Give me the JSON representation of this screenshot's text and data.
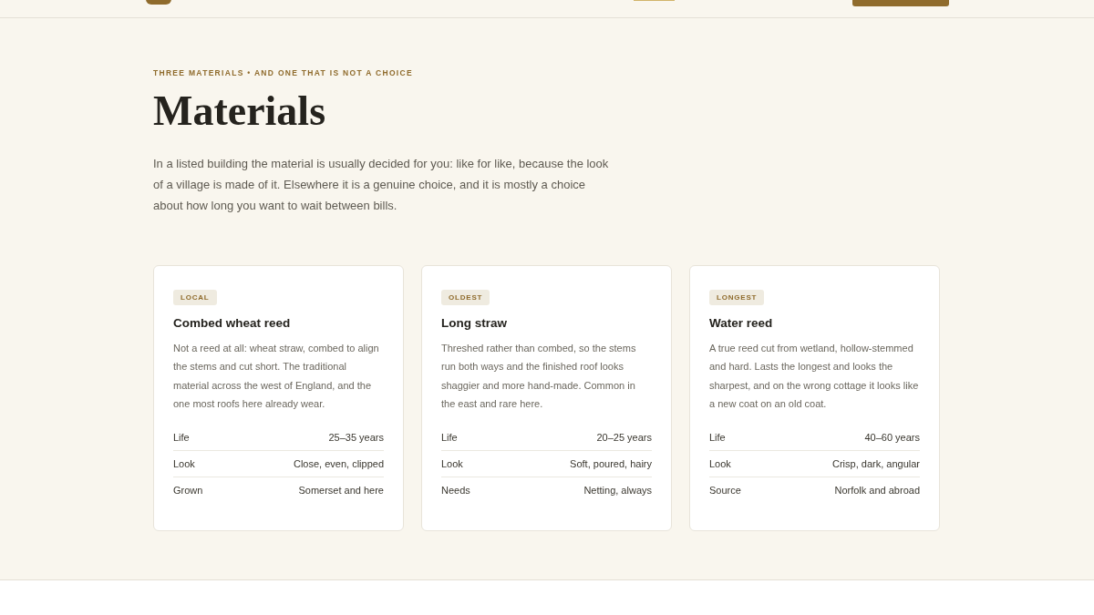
{
  "header": {
    "nav_active": true
  },
  "eyebrow": "THREE MATERIALS • AND ONE THAT IS NOT A CHOICE",
  "title": "Materials",
  "intro": "In a listed building the material is usually decided for you: like for like, because the look of a village is made of it. Elsewhere it is a genuine choice, and it is mostly a choice about how long you want to wait between bills.",
  "cards": [
    {
      "tag": "LOCAL",
      "name": "Combed wheat reed",
      "description": "Not a reed at all: wheat straw, combed to align the stems and cut short. The traditional material across the west of England, and the one most roofs here already wear.",
      "facts": [
        {
          "label": "Life",
          "value": "25–35 years"
        },
        {
          "label": "Look",
          "value": "Close, even, clipped"
        },
        {
          "label": "Grown",
          "value": "Somerset and here"
        }
      ]
    },
    {
      "tag": "OLDEST",
      "name": "Long straw",
      "description": "Threshed rather than combed, so the stems run both ways and the finished roof looks shaggier and more hand-made. Common in the east and rare here.",
      "facts": [
        {
          "label": "Life",
          "value": "20–25 years"
        },
        {
          "label": "Look",
          "value": "Soft, poured, hairy"
        },
        {
          "label": "Needs",
          "value": "Netting, always"
        }
      ]
    },
    {
      "tag": "LONGEST",
      "name": "Water reed",
      "description": "A true reed cut from wetland, hollow-stemmed and hard. Lasts the longest and looks the sharpest, and on the wrong cottage it looks like a new coat on an old coat.",
      "facts": [
        {
          "label": "Life",
          "value": "40–60 years"
        },
        {
          "label": "Look",
          "value": "Crisp, dark, angular"
        },
        {
          "label": "Source",
          "value": "Norfolk and abroad"
        }
      ]
    }
  ]
}
